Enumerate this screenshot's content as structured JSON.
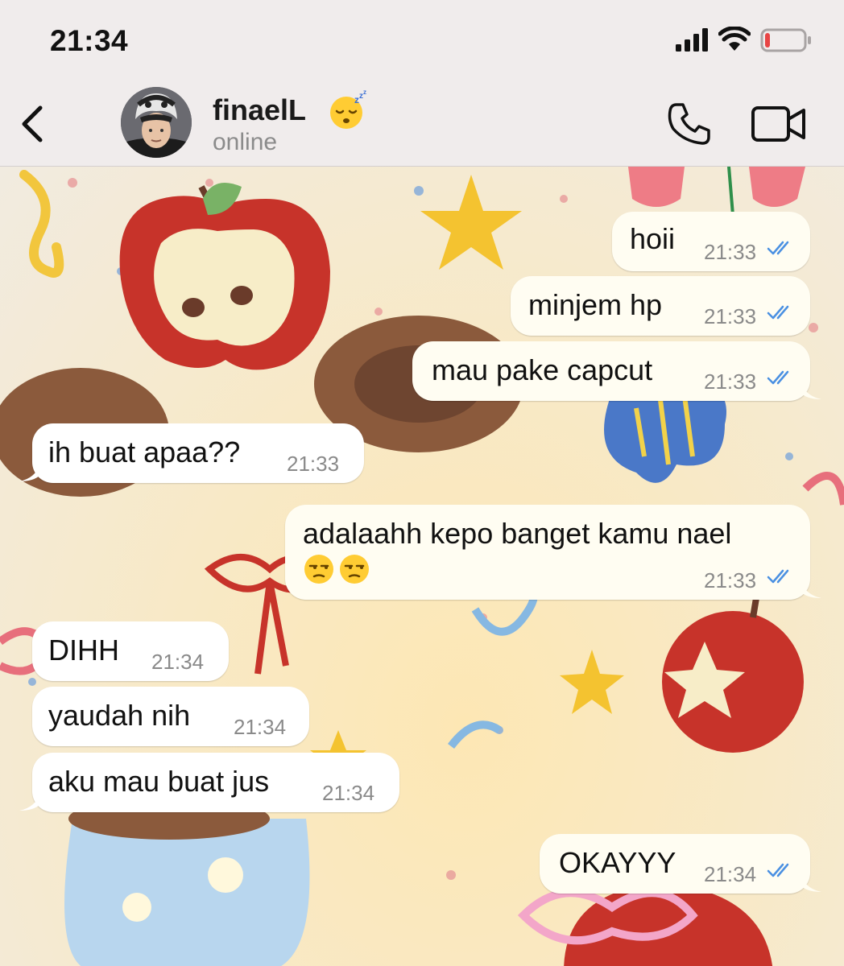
{
  "status_bar": {
    "time": "21:34",
    "icons": [
      "signal-icon",
      "wifi-icon",
      "battery-icon"
    ]
  },
  "header": {
    "back_icon": "chevron-left-icon",
    "contact_name": "finaelL",
    "name_emoji": "sleeping-face-emoji",
    "contact_status": "online",
    "call_icon": "phone-icon",
    "video_icon": "video-camera-icon"
  },
  "colors": {
    "outgoing_bubble": "#fffdf2",
    "incoming_bubble": "#ffffff",
    "read_ticks": "#4a90e2",
    "header_bg": "#f0ecec"
  },
  "messages": [
    {
      "direction": "out",
      "text": "hoii",
      "time": "21:33",
      "read": true
    },
    {
      "direction": "out",
      "text": "minjem hp",
      "time": "21:33",
      "read": true
    },
    {
      "direction": "out",
      "text": "mau pake capcut",
      "time": "21:33",
      "read": true
    },
    {
      "direction": "in",
      "text": "ih buat apaa??",
      "time": "21:33"
    },
    {
      "direction": "out",
      "text": "adalaahh kepo banget kamu nael",
      "emoji": "😒😒",
      "time": "21:33",
      "read": true
    },
    {
      "direction": "in",
      "text": "DIHH",
      "time": "21:34"
    },
    {
      "direction": "in",
      "text": "yaudah nih",
      "time": "21:34"
    },
    {
      "direction": "in",
      "text": "aku mau buat jus",
      "time": "21:34"
    },
    {
      "direction": "out",
      "text": "OKAYYY",
      "time": "21:34",
      "read": true
    }
  ]
}
